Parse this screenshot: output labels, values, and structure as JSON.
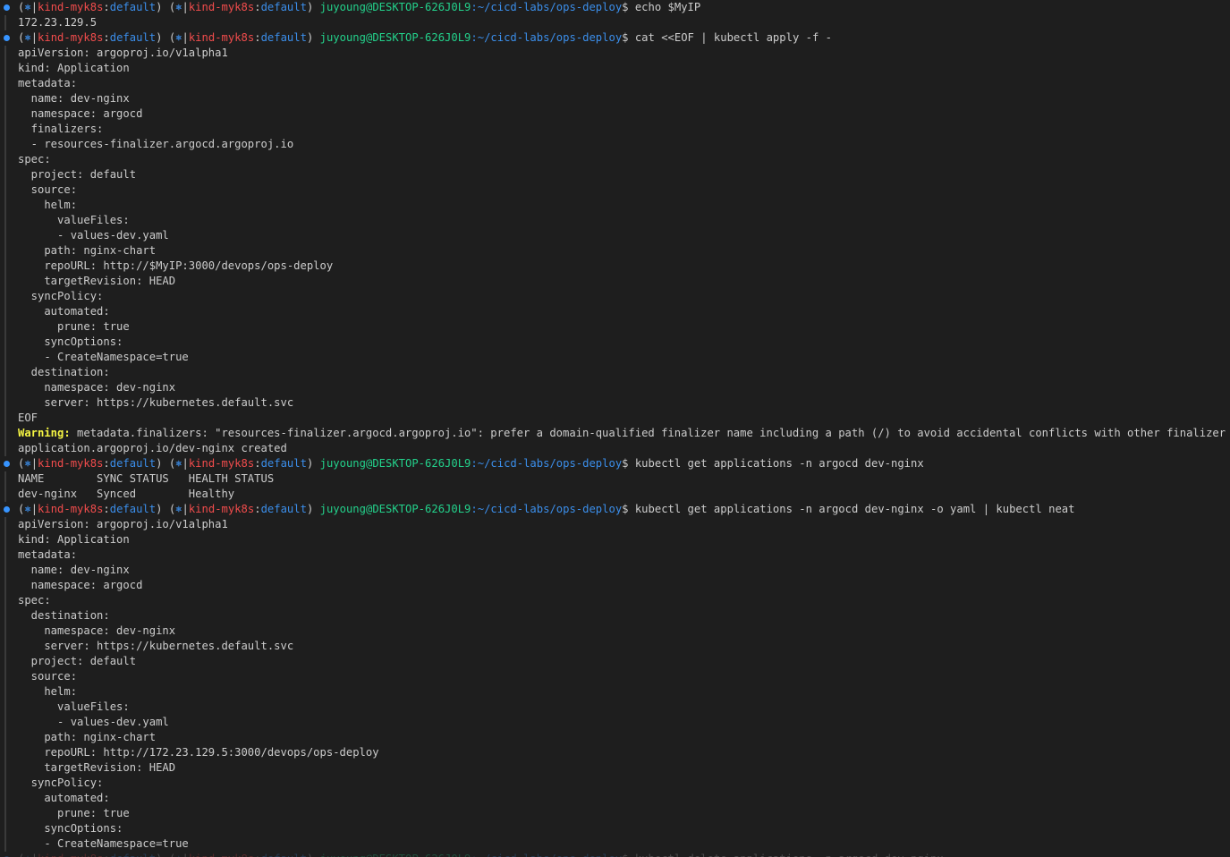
{
  "colors": {
    "background": "#1e1e1e",
    "text": "#cccccc",
    "context": "#f14c4c",
    "namespace": "#3b8eea",
    "user_host": "#23d18b",
    "path": "#3b8eea",
    "warning": "#f5f543",
    "command_marker": "#3794ff"
  },
  "prompt": {
    "open": "(",
    "icon": "⎈",
    "sep": "|",
    "context": "kind-myk8s",
    "colon": ":",
    "namespace": "default",
    "close": ") ",
    "user_host": "juyoung@DESKTOP-626J0L9",
    "path": ":~/cicd-labs/ops-deploy",
    "dollar": "$ "
  },
  "commands": {
    "echo": "echo $MyIP",
    "apply": "cat <<EOF | kubectl apply -f -",
    "get": "kubectl get applications -n argocd dev-nginx",
    "get_yaml": "kubectl get applications -n argocd dev-nginx -o yaml | kubectl neat",
    "last": "kubectl delete applications -n argocd dev-nginx"
  },
  "echo_output": [
    "172.23.129.5"
  ],
  "heredoc_lines": [
    "apiVersion: argoproj.io/v1alpha1",
    "kind: Application",
    "metadata:",
    "  name: dev-nginx",
    "  namespace: argocd",
    "  finalizers:",
    "  - resources-finalizer.argocd.argoproj.io",
    "spec:",
    "  project: default",
    "  source:",
    "    helm:",
    "      valueFiles:",
    "      - values-dev.yaml",
    "    path: nginx-chart",
    "    repoURL: http://$MyIP:3000/devops/ops-deploy",
    "    targetRevision: HEAD",
    "  syncPolicy:",
    "    automated:",
    "      prune: true",
    "    syncOptions:",
    "    - CreateNamespace=true",
    "  destination:",
    "    namespace: dev-nginx",
    "    server: https://kubernetes.default.svc",
    "EOF"
  ],
  "warning": {
    "label": "Warning:",
    "message": " metadata.finalizers: \"resources-finalizer.argocd.argoproj.io\": prefer a domain-qualified finalizer name including a path (/) to avoid accidental conflicts with other finalizer writers"
  },
  "apply_result": "application.argoproj.io/dev-nginx created",
  "get_output": [
    "NAME        SYNC STATUS   HEALTH STATUS",
    "dev-nginx   Synced        Healthy"
  ],
  "yaml_output": [
    "apiVersion: argoproj.io/v1alpha1",
    "kind: Application",
    "metadata:",
    "  name: dev-nginx",
    "  namespace: argocd",
    "spec:",
    "  destination:",
    "    namespace: dev-nginx",
    "    server: https://kubernetes.default.svc",
    "  project: default",
    "  source:",
    "    helm:",
    "      valueFiles:",
    "      - values-dev.yaml",
    "    path: nginx-chart",
    "    repoURL: http://172.23.129.5:3000/devops/ops-deploy",
    "    targetRevision: HEAD",
    "  syncPolicy:",
    "    automated:",
    "      prune: true",
    "    syncOptions:",
    "    - CreateNamespace=true"
  ]
}
